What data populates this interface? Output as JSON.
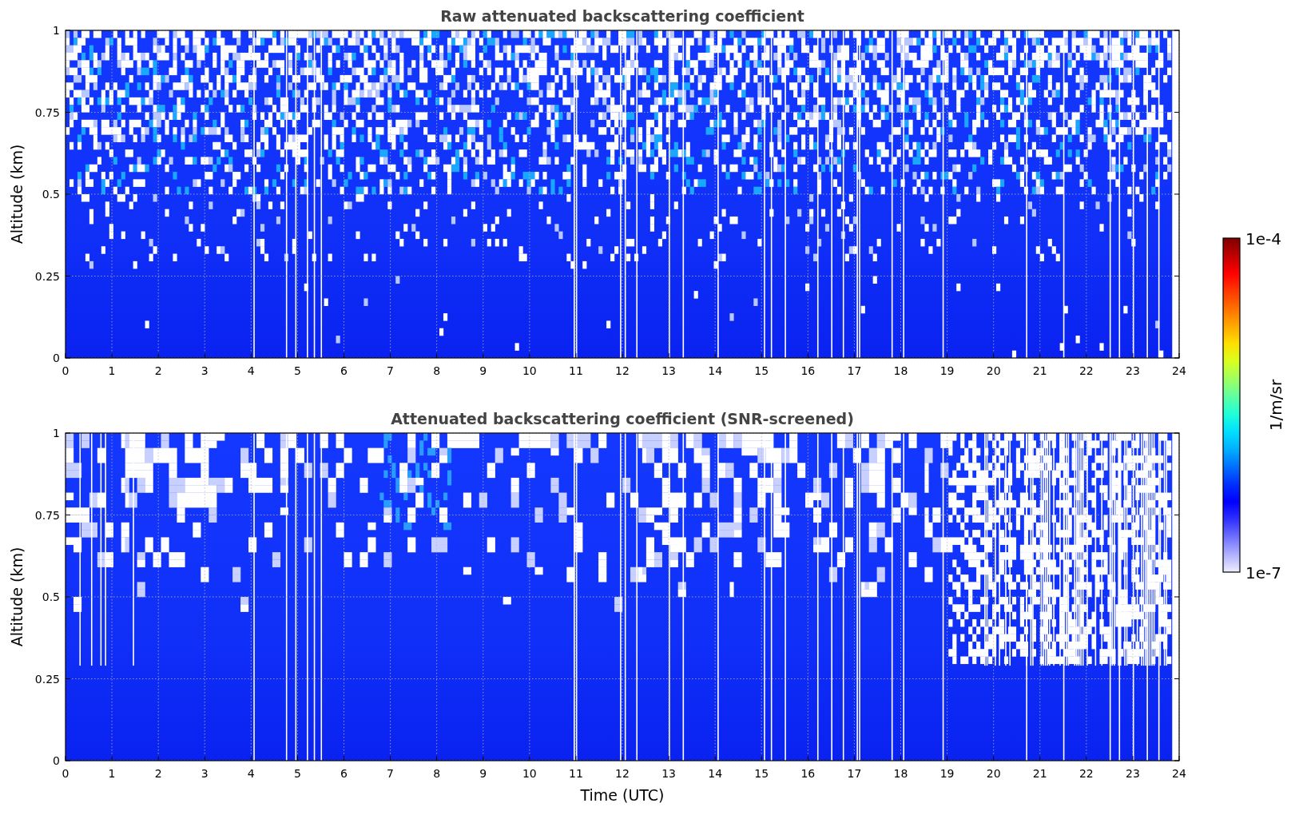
{
  "panels": [
    {
      "kind": "raw",
      "title": "Raw attenuated backscattering coefficient",
      "ylabel": "Altitude (km)",
      "yticks": [
        "1",
        "0.75",
        "0.5",
        "0.25",
        "0"
      ],
      "xticks": [
        "0",
        "1",
        "2",
        "3",
        "4",
        "5",
        "6",
        "7",
        "8",
        "9",
        "10",
        "11",
        "12",
        "13",
        "14",
        "15",
        "16",
        "17",
        "18",
        "19",
        "20",
        "21",
        "22",
        "23",
        "24"
      ]
    },
    {
      "kind": "screened",
      "title": "Attenuated backscattering coefficient (SNR-screened)",
      "ylabel": "Altitude (km)",
      "yticks": [
        "1",
        "0.75",
        "0.5",
        "0.25",
        "0"
      ],
      "xticks": [
        "0",
        "1",
        "2",
        "3",
        "4",
        "5",
        "6",
        "7",
        "8",
        "9",
        "10",
        "11",
        "12",
        "13",
        "14",
        "15",
        "16",
        "17",
        "18",
        "19",
        "20",
        "21",
        "22",
        "23",
        "24"
      ],
      "xlabel": "Time (UTC)"
    }
  ],
  "colorbar": {
    "max": "1e-4",
    "min": "1e-7",
    "label": "1/m/sr"
  }
}
